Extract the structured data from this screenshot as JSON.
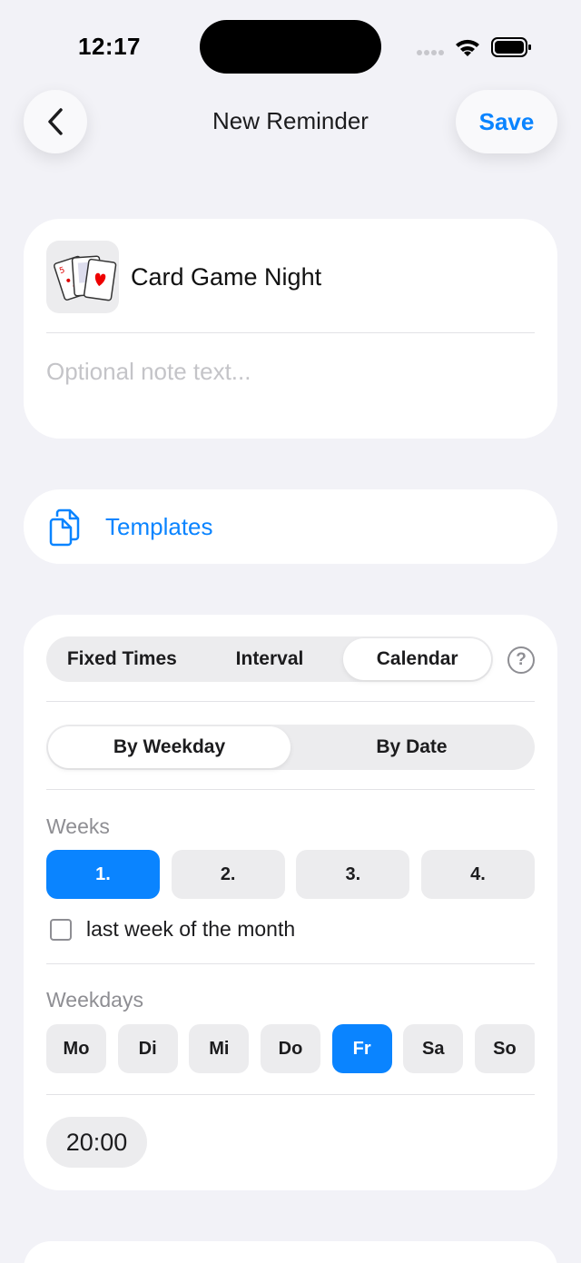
{
  "status_bar": {
    "time": "12:17"
  },
  "nav": {
    "title": "New Reminder",
    "save_label": "Save",
    "back_icon": "chevron-left-icon"
  },
  "reminder": {
    "icon": "playing-cards-icon",
    "title": "Card Game Night",
    "note_placeholder": "Optional note text..."
  },
  "templates": {
    "label": "Templates",
    "icon": "documents-icon"
  },
  "schedule": {
    "modes": [
      {
        "label": "Fixed Times",
        "active": false
      },
      {
        "label": "Interval",
        "active": false
      },
      {
        "label": "Calendar",
        "active": true
      }
    ],
    "help_glyph": "?",
    "calendar_modes": [
      {
        "label": "By Weekday",
        "active": true
      },
      {
        "label": "By Date",
        "active": false
      }
    ],
    "weeks_label": "Weeks",
    "weeks": [
      {
        "label": "1.",
        "selected": true
      },
      {
        "label": "2.",
        "selected": false
      },
      {
        "label": "3.",
        "selected": false
      },
      {
        "label": "4.",
        "selected": false
      }
    ],
    "last_week_label": "last week of the month",
    "last_week_checked": false,
    "weekdays_label": "Weekdays",
    "weekdays": [
      {
        "label": "Mo",
        "selected": false
      },
      {
        "label": "Di",
        "selected": false
      },
      {
        "label": "Mi",
        "selected": false
      },
      {
        "label": "Do",
        "selected": false
      },
      {
        "label": "Fr",
        "selected": true
      },
      {
        "label": "Sa",
        "selected": false
      },
      {
        "label": "So",
        "selected": false
      }
    ],
    "time": "20:00"
  },
  "colors": {
    "accent": "#0a84ff",
    "background": "#f2f2f7",
    "card": "#ffffff",
    "chip": "#ececee"
  }
}
